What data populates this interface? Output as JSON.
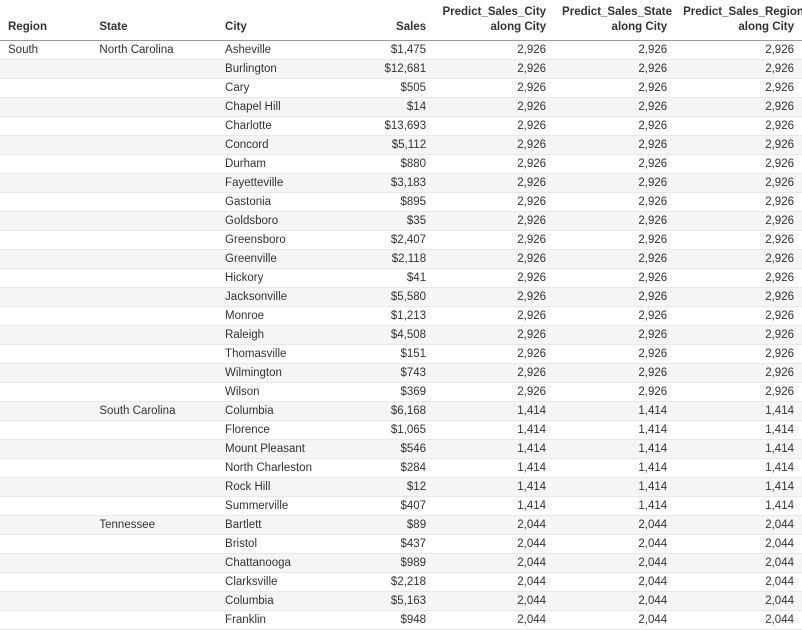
{
  "headers": {
    "region": "Region",
    "state": "State",
    "city": "City",
    "sales": "Sales",
    "predict_city": "Predict_Sales_City\nalong City",
    "predict_state": "Predict_Sales_State\nalong City",
    "predict_region": "Predict_Sales_Region\nalong City"
  },
  "rows": [
    {
      "region": "South",
      "state": "North Carolina",
      "city": "Asheville",
      "sales": "$1,475",
      "pCity": "2,926",
      "pState": "2,926",
      "pRegion": "2,926"
    },
    {
      "region": "",
      "state": "",
      "city": "Burlington",
      "sales": "$12,681",
      "pCity": "2,926",
      "pState": "2,926",
      "pRegion": "2,926"
    },
    {
      "region": "",
      "state": "",
      "city": "Cary",
      "sales": "$505",
      "pCity": "2,926",
      "pState": "2,926",
      "pRegion": "2,926"
    },
    {
      "region": "",
      "state": "",
      "city": "Chapel Hill",
      "sales": "$14",
      "pCity": "2,926",
      "pState": "2,926",
      "pRegion": "2,926"
    },
    {
      "region": "",
      "state": "",
      "city": "Charlotte",
      "sales": "$13,693",
      "pCity": "2,926",
      "pState": "2,926",
      "pRegion": "2,926"
    },
    {
      "region": "",
      "state": "",
      "city": "Concord",
      "sales": "$5,112",
      "pCity": "2,926",
      "pState": "2,926",
      "pRegion": "2,926"
    },
    {
      "region": "",
      "state": "",
      "city": "Durham",
      "sales": "$880",
      "pCity": "2,926",
      "pState": "2,926",
      "pRegion": "2,926"
    },
    {
      "region": "",
      "state": "",
      "city": "Fayetteville",
      "sales": "$3,183",
      "pCity": "2,926",
      "pState": "2,926",
      "pRegion": "2,926"
    },
    {
      "region": "",
      "state": "",
      "city": "Gastonia",
      "sales": "$895",
      "pCity": "2,926",
      "pState": "2,926",
      "pRegion": "2,926"
    },
    {
      "region": "",
      "state": "",
      "city": "Goldsboro",
      "sales": "$35",
      "pCity": "2,926",
      "pState": "2,926",
      "pRegion": "2,926"
    },
    {
      "region": "",
      "state": "",
      "city": "Greensboro",
      "sales": "$2,407",
      "pCity": "2,926",
      "pState": "2,926",
      "pRegion": "2,926"
    },
    {
      "region": "",
      "state": "",
      "city": "Greenville",
      "sales": "$2,118",
      "pCity": "2,926",
      "pState": "2,926",
      "pRegion": "2,926"
    },
    {
      "region": "",
      "state": "",
      "city": "Hickory",
      "sales": "$41",
      "pCity": "2,926",
      "pState": "2,926",
      "pRegion": "2,926"
    },
    {
      "region": "",
      "state": "",
      "city": "Jacksonville",
      "sales": "$5,580",
      "pCity": "2,926",
      "pState": "2,926",
      "pRegion": "2,926"
    },
    {
      "region": "",
      "state": "",
      "city": "Monroe",
      "sales": "$1,213",
      "pCity": "2,926",
      "pState": "2,926",
      "pRegion": "2,926"
    },
    {
      "region": "",
      "state": "",
      "city": "Raleigh",
      "sales": "$4,508",
      "pCity": "2,926",
      "pState": "2,926",
      "pRegion": "2,926"
    },
    {
      "region": "",
      "state": "",
      "city": "Thomasville",
      "sales": "$151",
      "pCity": "2,926",
      "pState": "2,926",
      "pRegion": "2,926"
    },
    {
      "region": "",
      "state": "",
      "city": "Wilmington",
      "sales": "$743",
      "pCity": "2,926",
      "pState": "2,926",
      "pRegion": "2,926"
    },
    {
      "region": "",
      "state": "",
      "city": "Wilson",
      "sales": "$369",
      "pCity": "2,926",
      "pState": "2,926",
      "pRegion": "2,926"
    },
    {
      "region": "",
      "state": "South Carolina",
      "city": "Columbia",
      "sales": "$6,168",
      "pCity": "1,414",
      "pState": "1,414",
      "pRegion": "1,414"
    },
    {
      "region": "",
      "state": "",
      "city": "Florence",
      "sales": "$1,065",
      "pCity": "1,414",
      "pState": "1,414",
      "pRegion": "1,414"
    },
    {
      "region": "",
      "state": "",
      "city": "Mount Pleasant",
      "sales": "$546",
      "pCity": "1,414",
      "pState": "1,414",
      "pRegion": "1,414"
    },
    {
      "region": "",
      "state": "",
      "city": "North Charleston",
      "sales": "$284",
      "pCity": "1,414",
      "pState": "1,414",
      "pRegion": "1,414"
    },
    {
      "region": "",
      "state": "",
      "city": "Rock Hill",
      "sales": "$12",
      "pCity": "1,414",
      "pState": "1,414",
      "pRegion": "1,414"
    },
    {
      "region": "",
      "state": "",
      "city": "Summerville",
      "sales": "$407",
      "pCity": "1,414",
      "pState": "1,414",
      "pRegion": "1,414"
    },
    {
      "region": "",
      "state": "Tennessee",
      "city": "Bartlett",
      "sales": "$89",
      "pCity": "2,044",
      "pState": "2,044",
      "pRegion": "2,044"
    },
    {
      "region": "",
      "state": "",
      "city": "Bristol",
      "sales": "$437",
      "pCity": "2,044",
      "pState": "2,044",
      "pRegion": "2,044"
    },
    {
      "region": "",
      "state": "",
      "city": "Chattanooga",
      "sales": "$989",
      "pCity": "2,044",
      "pState": "2,044",
      "pRegion": "2,044"
    },
    {
      "region": "",
      "state": "",
      "city": "Clarksville",
      "sales": "$2,218",
      "pCity": "2,044",
      "pState": "2,044",
      "pRegion": "2,044"
    },
    {
      "region": "",
      "state": "",
      "city": "Columbia",
      "sales": "$5,163",
      "pCity": "2,044",
      "pState": "2,044",
      "pRegion": "2,044"
    },
    {
      "region": "",
      "state": "",
      "city": "Franklin",
      "sales": "$948",
      "pCity": "2,044",
      "pState": "2,044",
      "pRegion": "2,044"
    }
  ]
}
